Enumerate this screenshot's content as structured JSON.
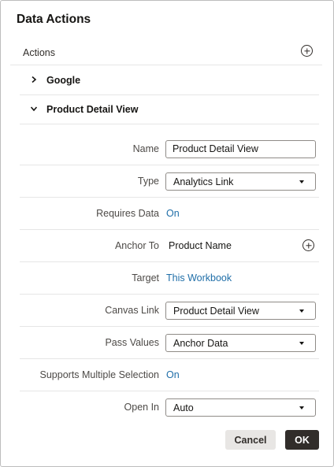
{
  "dialog": {
    "title": "Data Actions",
    "actions_label": "Actions",
    "sections": [
      {
        "label": "Google",
        "expanded": false
      },
      {
        "label": "Product Detail View",
        "expanded": true
      }
    ],
    "fields": {
      "name": {
        "label": "Name",
        "value": "Product Detail View"
      },
      "type": {
        "label": "Type",
        "value": "Analytics Link"
      },
      "requires_data": {
        "label": "Requires Data",
        "value": "On"
      },
      "anchor_to": {
        "label": "Anchor To",
        "value": "Product Name"
      },
      "target": {
        "label": "Target",
        "value": "This Workbook"
      },
      "canvas_link": {
        "label": "Canvas Link",
        "value": "Product Detail View"
      },
      "pass_values": {
        "label": "Pass Values",
        "value": "Anchor Data"
      },
      "supports_multiple_selection": {
        "label": "Supports Multiple Selection",
        "value": "On"
      },
      "open_in": {
        "label": "Open In",
        "value": "Auto"
      }
    },
    "buttons": {
      "cancel": "Cancel",
      "ok": "OK"
    }
  },
  "colors": {
    "link": "#1f6ea8",
    "primary_button": "#312d2a",
    "secondary_button": "#e8e6e4"
  },
  "icons": [
    "add-circle-icon",
    "chevron-right-icon",
    "chevron-down-icon",
    "caret-down-icon"
  ]
}
